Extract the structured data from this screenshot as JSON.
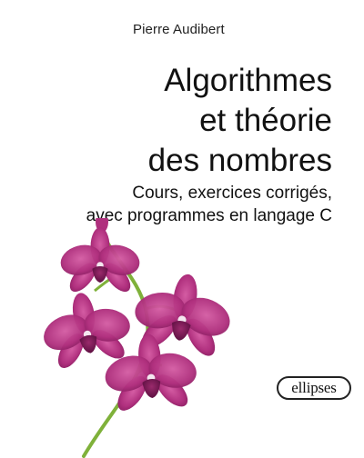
{
  "cover": {
    "author": "Pierre Audibert",
    "title_lines": [
      "Algorithmes",
      "et théorie",
      "des nombres"
    ],
    "subtitle_lines": [
      "Cours, exercices corrigés,",
      "avec programmes en langage C"
    ],
    "publisher": "ellipses",
    "colors": {
      "orchid_petal": "#b0307e",
      "orchid_dark": "#6e1450",
      "stem": "#7fb13a",
      "background": "#ffffff"
    },
    "illustration": "orchid-branch"
  }
}
